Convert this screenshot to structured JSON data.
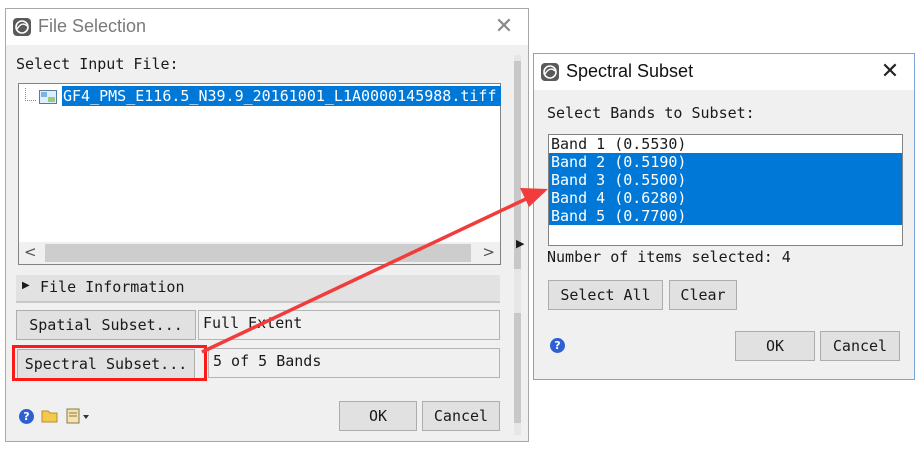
{
  "file_selection": {
    "title": "File Selection",
    "select_label": "Select Input File:",
    "file_name": "GF4_PMS_E116.5_N39.9_20161001_L1A0000145988.tiff",
    "file_information_label": "File Information",
    "spatial_subset_button": "Spatial Subset...",
    "spatial_subset_value": "Full Extent",
    "spectral_subset_button": "Spectral Subset...",
    "spectral_subset_value": "5 of 5 Bands",
    "ok_button": "OK",
    "cancel_button": "Cancel",
    "scroll_left": "<",
    "scroll_right": ">"
  },
  "spectral_subset": {
    "title": "Spectral Subset",
    "select_label": "Select Bands to Subset:",
    "bands": [
      {
        "label": "Band 1 (0.5530)",
        "selected": false
      },
      {
        "label": "Band 2 (0.5190)",
        "selected": true
      },
      {
        "label": "Band 3 (0.5500)",
        "selected": true
      },
      {
        "label": "Band 4 (0.6280)",
        "selected": true
      },
      {
        "label": "Band 5 (0.7700)",
        "selected": true
      }
    ],
    "count_label": "Number of items selected: 4",
    "select_all_button": "Select All",
    "clear_button": "Clear",
    "ok_button": "OK",
    "cancel_button": "Cancel"
  },
  "colors": {
    "selection": "#0078d7",
    "highlight_box": "#ff1a1a",
    "arrow": "#f23c3c"
  }
}
